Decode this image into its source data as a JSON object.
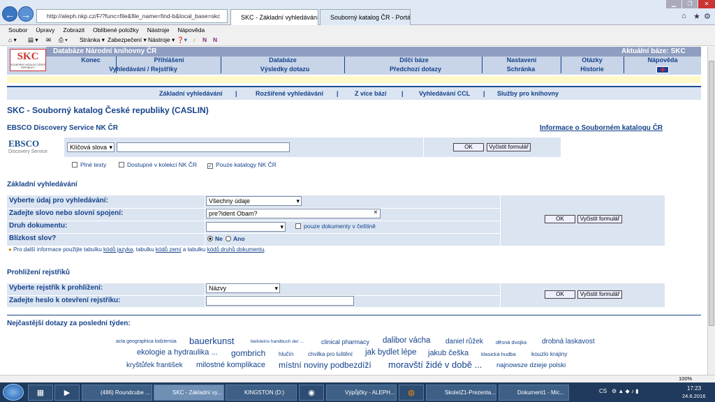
{
  "browser": {
    "back": "←",
    "forward": "→",
    "address": "http://aleph.nkp.cz/F/?func=file&file_name=find-b&local_base=skc",
    "tab1": "SKC - Základní vyhledávání",
    "tab2": "Souborný katalog ČR - Portál ...",
    "search_icon": "search-icon",
    "refresh_icon": "refresh-icon"
  },
  "menu": [
    "Soubor",
    "Úpravy",
    "Zobrazit",
    "Oblíbené položky",
    "Nástroje",
    "Nápověda"
  ],
  "commands": [
    "Stránka ▾",
    "Zabezpečení ▾",
    "Nástroje ▾"
  ],
  "header": {
    "db_title": "Databáze Národní knihovny ČR",
    "current_label": "Aktuální báze:  SKC",
    "logo": "SKC",
    "logo_sub": "SOUBORNÝ KATALOG ČESKÉ REPUBLIKY",
    "row1": [
      "Konec",
      "Přihlášení",
      "Databáze",
      "Dílčí báze",
      "Nastavení",
      "Otázky",
      "Nápověda"
    ],
    "row2": [
      "Vyhledávání / Rejstříky",
      "Výsledky dotazu",
      "Předchozí dotazy",
      "Schránka",
      "Historie"
    ]
  },
  "subnav": [
    "Základní vyhledávání",
    "|",
    "Rozšířené vyhledávání",
    "|",
    "Z více bází",
    "|",
    "Vyhledávání CCL",
    "|",
    "Služby pro knihovny"
  ],
  "page_title": "SKC - Souborný katalog České republiky (CASLIN)",
  "ebsco": {
    "title": "EBSCO Discovery Service NK ČR",
    "info_link": "Informace o Souborném katalogu ČR",
    "logo": "EBSCO",
    "logo_sub": "Discovery Service",
    "select": "Klíčová slova",
    "ok": "OK",
    "clear": "Vyčistit formulář",
    "opt1": "Plné texty",
    "opt2": "Dostupné v kolekci NK ČR",
    "opt3": "Pouze katalogy NK ČR"
  },
  "basic": {
    "title": "Základní vyhledávání",
    "l1": "Vyberte údaj pro vyhledávání:",
    "v1": "Všechny údaje",
    "l2": "Zadejte slovo nebo slovní spojení:",
    "v2": "pre?ident Obam?",
    "l3": "Druh dokumentu:",
    "v3": "",
    "czech_only": "pouze dokumenty v češtině",
    "l4": "Blízkost slov?",
    "ne": "Ne",
    "ano": "Ano",
    "note1": "Pro další informace použijte tabulku ",
    "link1": "kódů jazyka",
    "note2": ", tabulku ",
    "link2": "kódů zemí",
    "note3": " a tabulku ",
    "link3": "kódů druhů dokumentu",
    "note4": ".",
    "ok": "OK",
    "clear": "Vyčistit formulář"
  },
  "browse": {
    "title": "Prohlížení rejstříků",
    "l1": "Vyberte rejstřík k prohlížení:",
    "v1": "Názvy",
    "l2": "Zadejte heslo k otevření rejstříku:",
    "ok": "OK",
    "clear": "Vyčistit formulář"
  },
  "popular": {
    "title": "Nejčastější dotazy za poslední týden:",
    "row1": [
      "acta geographica lodziensia",
      "bauerkunst",
      "beilsteins handbuch der ...",
      "clinical pharmacy",
      "dalibor vácha",
      "daniel růžek",
      "děsná dvojka",
      "drobná laskavost"
    ],
    "row2": [
      "ekologie a hydraulika ...",
      "gombrich",
      "hlučín",
      "chvilka pro luštění",
      "jak bydlet lépe",
      "jakub češka",
      "klasická hudba",
      "kouzlo krajiny"
    ],
    "row3": [
      "kryštůfek františek",
      "milostné komplikace",
      "místní noviny podbezdíží",
      "moravští židé v době ...",
      "najnowsze dzieje polski"
    ]
  },
  "zoom": "100%",
  "taskbar": {
    "items": [
      "(486) Roundcube ...",
      "SKC - Základní vy...",
      "KINGSTON (D:)",
      "",
      "Výpůjčky - ALEPH...",
      "",
      "SkoleIZ1-Prezenta...",
      "Dokument1 - Mic..."
    ],
    "time": "17:23",
    "date": "24.6.2016",
    "lang": "CS"
  }
}
